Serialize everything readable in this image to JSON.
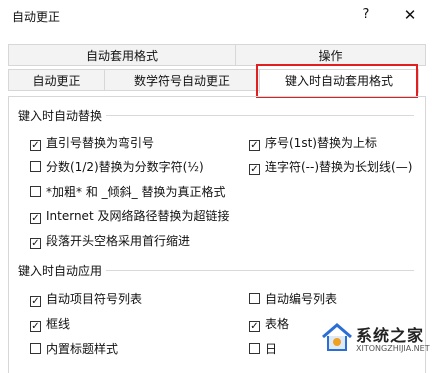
{
  "window": {
    "title": "自动更正",
    "help_label": "?",
    "close_label": "✕"
  },
  "tabs_back": [
    {
      "label": "自动套用格式"
    },
    {
      "label": "操作"
    }
  ],
  "tabs_front": [
    {
      "label": "自动更正"
    },
    {
      "label": "数学符号自动更正"
    },
    {
      "label": "键入时自动套用格式",
      "active": true
    }
  ],
  "section_replace": {
    "title": "键入时自动替换",
    "options": [
      {
        "label": "直引号替换为弯引号",
        "checked": true
      },
      {
        "label": "序号(1st)替换为上标",
        "checked": true
      },
      {
        "label": "分数(1/2)替换为分数字符(½)",
        "checked": false
      },
      {
        "label": "连字符(--)替换为长划线(—)",
        "checked": true
      },
      {
        "label": "*加粗* 和 _倾斜_ 替换为真正格式",
        "checked": false
      },
      {
        "label": "Internet 及网络路径替换为超链接",
        "checked": true
      },
      {
        "label": "段落开头空格采用首行缩进",
        "checked": true
      }
    ]
  },
  "section_apply": {
    "title": "键入时自动应用",
    "options": [
      {
        "label": "自动项目符号列表",
        "checked": true
      },
      {
        "label": "自动编号列表",
        "checked": false
      },
      {
        "label": "框线",
        "checked": true
      },
      {
        "label": "表格",
        "checked": true
      },
      {
        "label": "内置标题样式",
        "checked": false
      },
      {
        "label": "日",
        "checked": false
      }
    ]
  },
  "watermark": {
    "name": "系统之家",
    "url": "XITONGZHIJIA.NET"
  },
  "colors": {
    "highlight": "#e02020",
    "tab_bg": "#f3f3f3",
    "border": "#d7d7d7"
  }
}
